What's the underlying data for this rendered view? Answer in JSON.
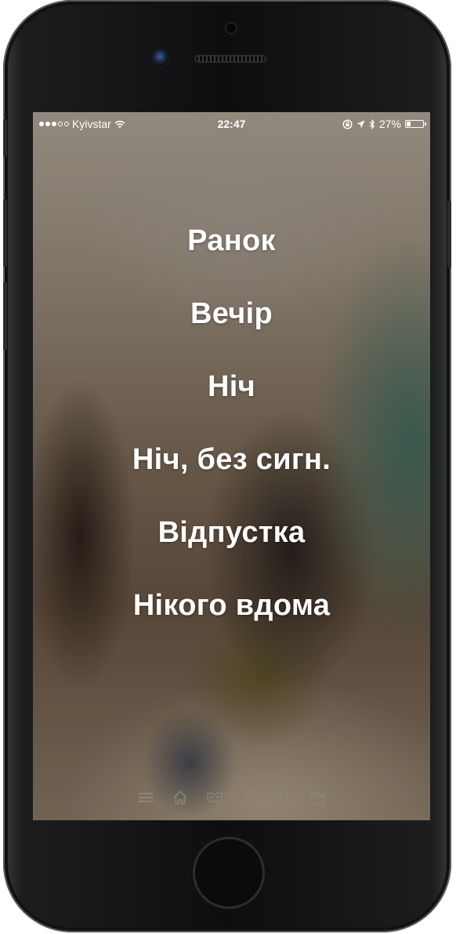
{
  "status_bar": {
    "carrier": "Kyivstar",
    "time": "22:47",
    "battery_percent": "27%",
    "battery_level": 0.27,
    "signal_bars_filled": 3,
    "signal_bars_total": 5
  },
  "scenes_menu": {
    "items": [
      {
        "label": "Ранок"
      },
      {
        "label": "Вечір"
      },
      {
        "label": "Ніч"
      },
      {
        "label": "Ніч, без сигн."
      },
      {
        "label": "Відпустка"
      },
      {
        "label": "Нікого вдома"
      }
    ]
  },
  "tab_bar": {
    "icons": [
      "menu-icon",
      "home-icon",
      "security-mask-icon",
      "key-icon",
      "music-icon",
      "folder-icon"
    ]
  },
  "colors": {
    "text": "#ffffff",
    "tab_icon": "#8c857c"
  }
}
